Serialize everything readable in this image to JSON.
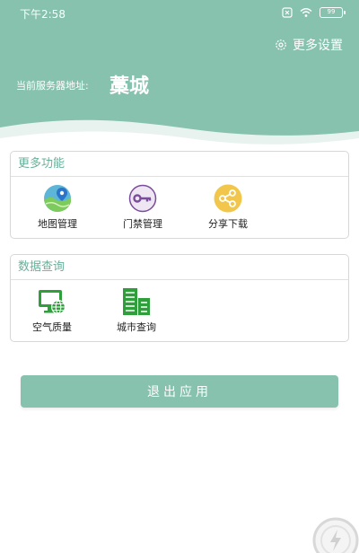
{
  "status_bar": {
    "time": "下午2:58",
    "battery": "99"
  },
  "header": {
    "more_settings": "更多设置",
    "server_label": "当前服务器地址:",
    "server_value": "藁城"
  },
  "more_functions": {
    "title": "更多功能",
    "items": [
      {
        "label": "地图管理",
        "icon": "map-icon"
      },
      {
        "label": "门禁管理",
        "icon": "key-icon"
      },
      {
        "label": "分享下载",
        "icon": "share-icon"
      }
    ]
  },
  "data_query": {
    "title": "数据查询",
    "items": [
      {
        "label": "空气质量",
        "icon": "air-quality-icon"
      },
      {
        "label": "城市查询",
        "icon": "city-icon"
      }
    ]
  },
  "exit_button": "退出应用",
  "colors": {
    "header_green": "#86c2ad",
    "section_title": "#6ab09a",
    "icon_green": "#2e9f3a",
    "key_purple": "#7a4d9a",
    "share_yellow": "#f2c64a"
  }
}
